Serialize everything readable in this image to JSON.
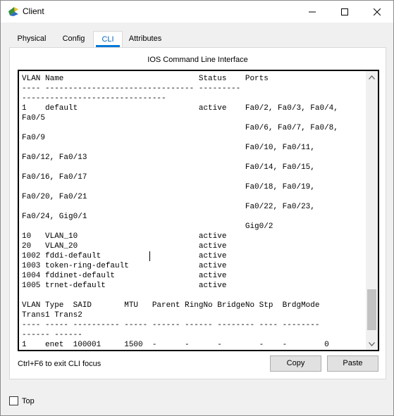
{
  "window": {
    "title": "Client"
  },
  "tabs": [
    {
      "label": "Physical",
      "active": false
    },
    {
      "label": "Config",
      "active": false
    },
    {
      "label": "CLI",
      "active": true
    },
    {
      "label": "Attributes",
      "active": false
    }
  ],
  "panel": {
    "caption": "IOS Command Line Interface"
  },
  "cli": {
    "lines": [
      "VLAN Name                             Status    Ports",
      "---- -------------------------------- ---------",
      "-------------------------------",
      "1    default                          active    Fa0/2, Fa0/3, Fa0/4,",
      "Fa0/5",
      "                                                Fa0/6, Fa0/7, Fa0/8,",
      "Fa0/9",
      "                                                Fa0/10, Fa0/11,",
      "Fa0/12, Fa0/13",
      "                                                Fa0/14, Fa0/15,",
      "Fa0/16, Fa0/17",
      "                                                Fa0/18, Fa0/19,",
      "Fa0/20, Fa0/21",
      "                                                Fa0/22, Fa0/23,",
      "Fa0/24, Gig0/1",
      "                                                Gig0/2",
      "10   VLAN_10                          active",
      "20   VLAN_20                          active",
      "1002 fddi-default                     active",
      "1003 token-ring-default               active",
      "1004 fddinet-default                  active",
      "1005 trnet-default                    active",
      "",
      "VLAN Type  SAID       MTU   Parent RingNo BridgeNo Stp  BrdgMode",
      "Trans1 Trans2",
      "---- ----- ---------- ----- ------ ------ -------- ---- --------",
      "------ ------",
      "1    enet  100001     1500  -      -      -        -    -        0"
    ]
  },
  "footer": {
    "hint": "Ctrl+F6 to exit CLI focus",
    "copy_label": "Copy",
    "paste_label": "Paste"
  },
  "bottom": {
    "top_label": "Top",
    "top_checked": false
  },
  "colors": {
    "accent": "#0078d7",
    "tab_active_text": "#0067c0"
  },
  "icons": [
    "app-icon",
    "minimize-icon",
    "maximize-icon",
    "close-icon",
    "scroll-up-icon",
    "scroll-down-icon"
  ]
}
